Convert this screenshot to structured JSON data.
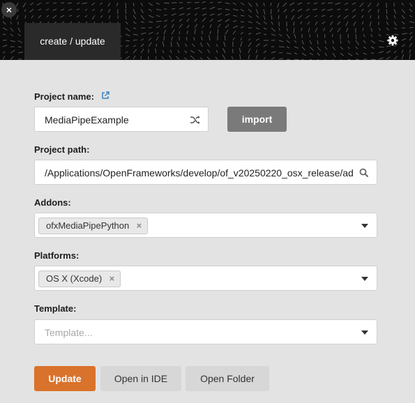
{
  "window": {
    "close_glyph": "×"
  },
  "header": {
    "tab_label": "create / update",
    "settings_icon": "gear-icon"
  },
  "project_name": {
    "label": "Project name:",
    "external_icon": "external-link-icon",
    "value": "MediaPipeExample",
    "shuffle_icon": "shuffle-icon"
  },
  "import_button": {
    "label": "import"
  },
  "project_path": {
    "label": "Project path:",
    "value": "/Applications/OpenFrameworks/develop/of_v20250220_osx_release/ad",
    "search_icon": "search-icon"
  },
  "addons": {
    "label": "Addons:",
    "tags": [
      "ofxMediaPipePython"
    ]
  },
  "platforms": {
    "label": "Platforms:",
    "tags": [
      "OS X (Xcode)"
    ]
  },
  "template": {
    "label": "Template:",
    "placeholder": "Template..."
  },
  "actions": {
    "update": "Update",
    "open_ide": "Open in IDE",
    "open_folder": "Open Folder"
  },
  "colors": {
    "accent": "#d9722b",
    "import_bg": "#7a7a7a",
    "header_bg": "#0c0c0c",
    "tab_bg": "#2a2a2a",
    "link_blue": "#3b82c4"
  }
}
